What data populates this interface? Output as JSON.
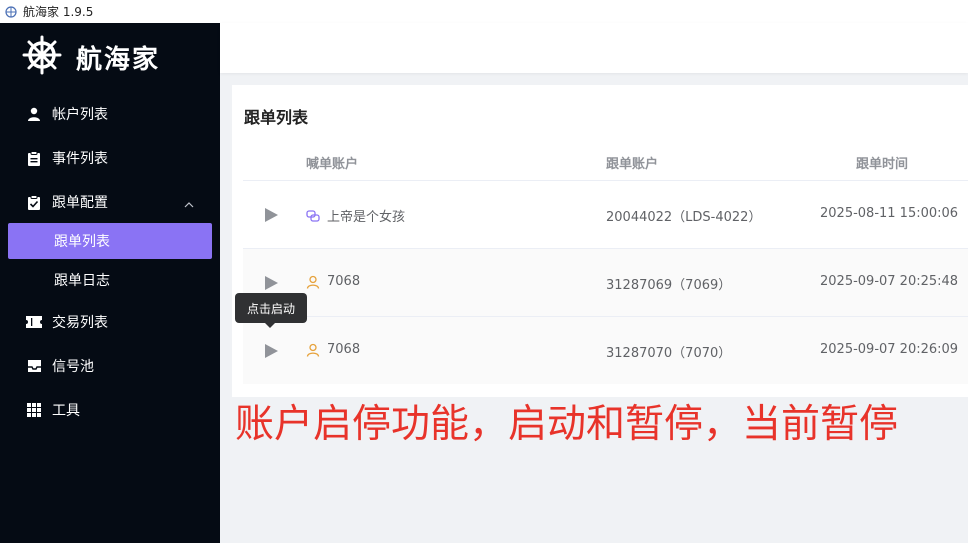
{
  "window": {
    "title": "航海家 1.9.5"
  },
  "brand": {
    "name": "航海家"
  },
  "sidebar": {
    "items": [
      {
        "label": "帐户列表",
        "icon": "user-icon"
      },
      {
        "label": "事件列表",
        "icon": "clipboard-icon"
      },
      {
        "label": "跟单配置",
        "icon": "clipboard-check-icon",
        "expanded": true,
        "children": [
          {
            "label": "跟单列表",
            "active": true
          },
          {
            "label": "跟单日志",
            "active": false
          }
        ]
      },
      {
        "label": "交易列表",
        "icon": "ticket-icon"
      },
      {
        "label": "信号池",
        "icon": "inbox-icon"
      },
      {
        "label": "工具",
        "icon": "grid-icon"
      }
    ]
  },
  "main": {
    "title": "跟单列表",
    "columns": [
      "喊单账户",
      "跟单账户",
      "跟单时间"
    ],
    "rows": [
      {
        "action_icon": "play-icon",
        "caller_icon": "link-icon",
        "caller": "上帝是个女孩",
        "follower": "20044022（LDS-4022）",
        "time": "2025-08-11 15:00:06"
      },
      {
        "action_icon": "play-icon",
        "caller_icon": "user-icon",
        "caller": "7068",
        "follower": "31287069（7069）",
        "time": "2025-09-07 20:25:48"
      },
      {
        "action_icon": "play-icon",
        "caller_icon": "user-icon",
        "caller": "7068",
        "follower": "31287070（7070）",
        "time": "2025-09-07 20:26:09"
      }
    ],
    "tooltip": "点击启动"
  },
  "annotation": "账户启停功能，启动和暂停，当前暂停",
  "colors": {
    "sidebar_bg": "#050b14",
    "accent": "#8a73f4",
    "annotation": "#e8332a",
    "tooltip_bg": "#303133"
  }
}
